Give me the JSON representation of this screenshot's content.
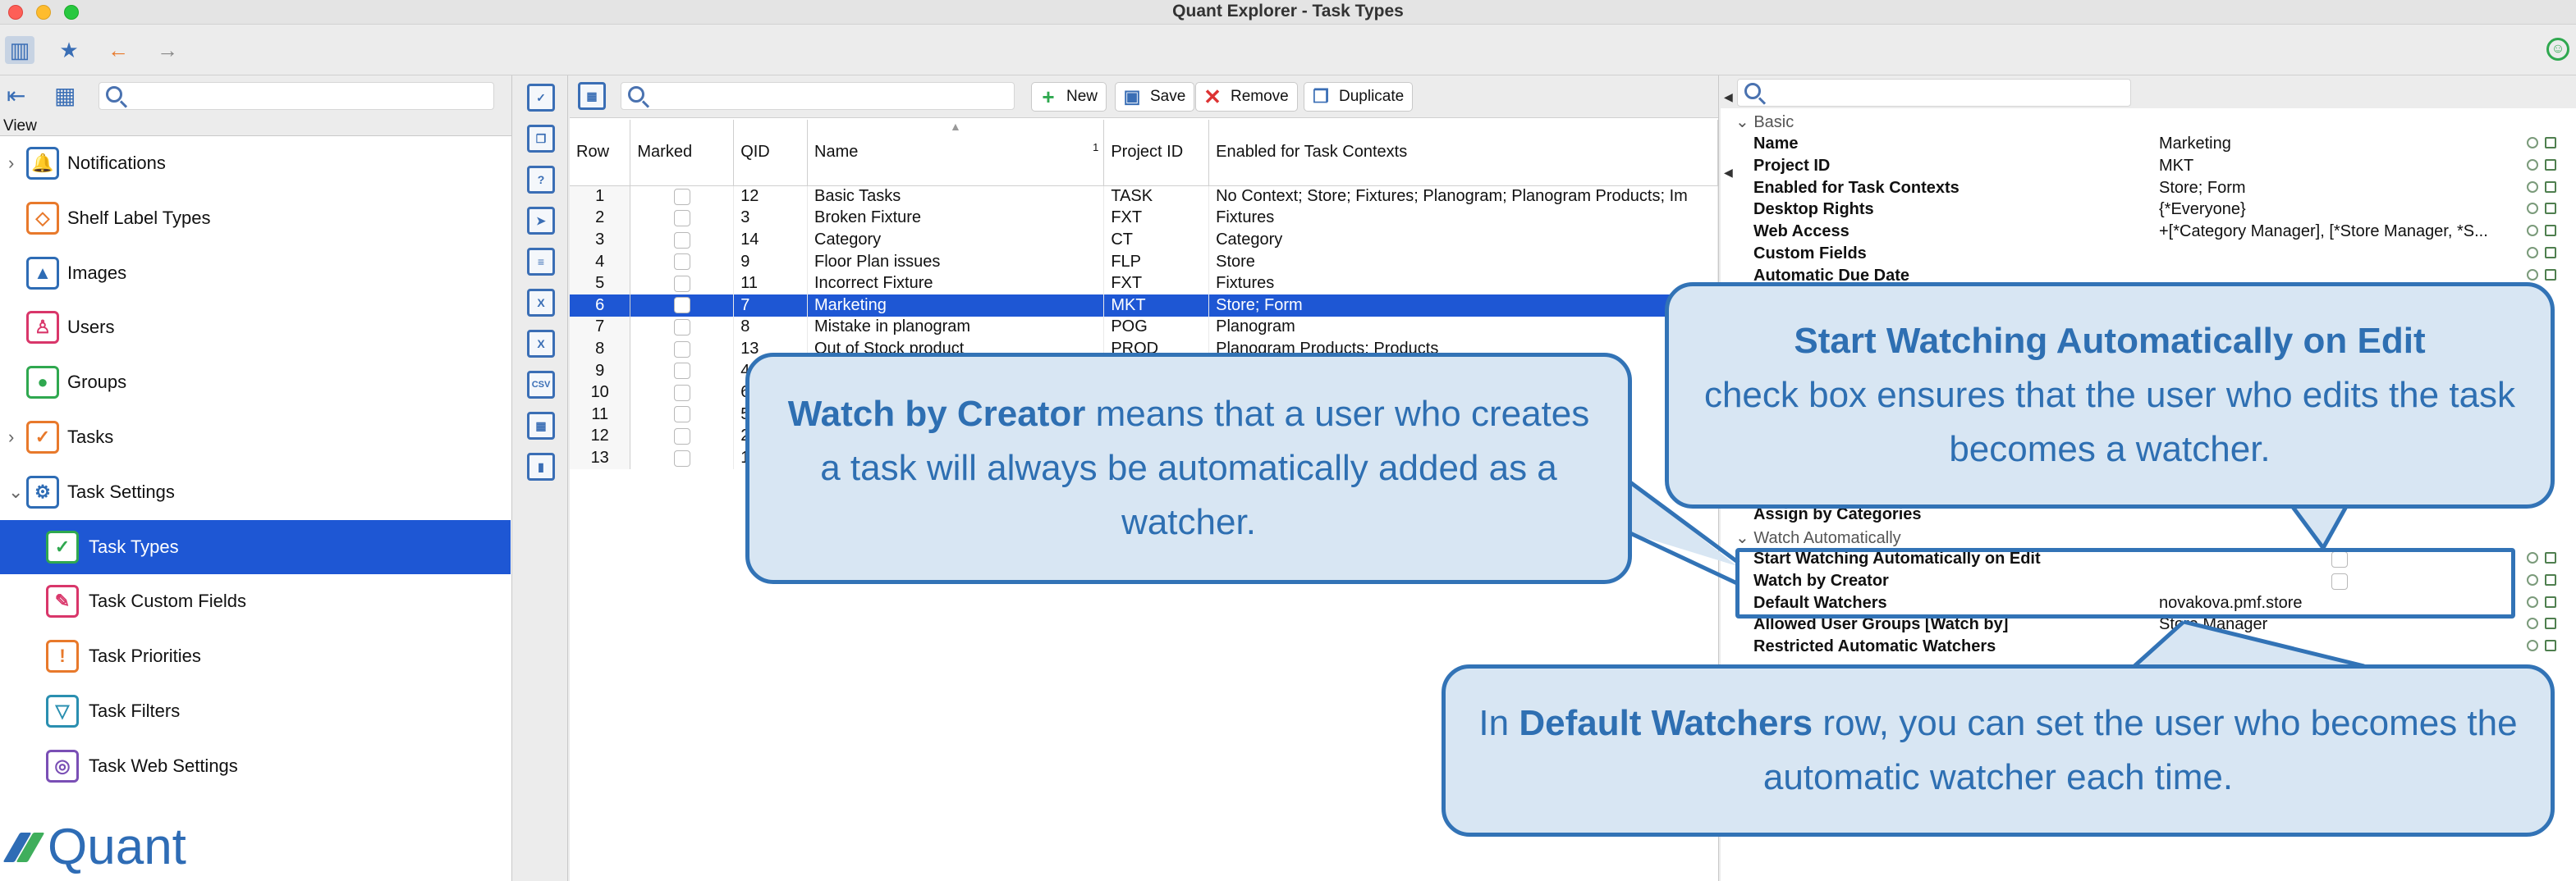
{
  "window": {
    "title": "Quant Explorer - Task Types"
  },
  "left": {
    "view_label": "View",
    "nav": [
      {
        "label": "Notifications",
        "icon": "bell-icon",
        "expandable": true
      },
      {
        "label": "Shelf Label Types",
        "icon": "shelf-label-icon",
        "expandable": false
      },
      {
        "label": "Images",
        "icon": "image-icon",
        "expandable": false
      },
      {
        "label": "Users",
        "icon": "user-icon",
        "expandable": false
      },
      {
        "label": "Groups",
        "icon": "group-icon",
        "expandable": false
      },
      {
        "label": "Tasks",
        "icon": "task-check-icon",
        "expandable": true
      },
      {
        "label": "Task Settings",
        "icon": "task-settings-icon",
        "expandable": true
      },
      {
        "label": "Task Types",
        "icon": "task-types-icon",
        "selected": true
      },
      {
        "label": "Task Custom Fields",
        "icon": "task-custom-fields-icon"
      },
      {
        "label": "Task Priorities",
        "icon": "task-priorities-icon"
      },
      {
        "label": "Task Filters",
        "icon": "task-filters-icon"
      },
      {
        "label": "Task Web Settings",
        "icon": "task-web-icon"
      }
    ],
    "logo_text": "Quant"
  },
  "toolbar": {
    "new_label": "New",
    "save_label": "Save",
    "remove_label": "Remove",
    "duplicate_label": "Duplicate"
  },
  "table": {
    "columns": [
      "Row",
      "Marked",
      "QID",
      "Name",
      "Project ID",
      "Enabled for Task Contexts"
    ],
    "sort_indicator": "1",
    "rows": [
      [
        "1",
        "",
        "12",
        "Basic Tasks",
        "TASK",
        "No Context; Store; Fixtures; Planogram; Planogram Products; Im"
      ],
      [
        "2",
        "",
        "3",
        "Broken Fixture",
        "FXT",
        "Fixtures"
      ],
      [
        "3",
        "",
        "14",
        "Category",
        "CT",
        "Category"
      ],
      [
        "4",
        "",
        "9",
        "Floor Plan issues",
        "FLP",
        "Store"
      ],
      [
        "5",
        "",
        "11",
        "Incorrect Fixture",
        "FXT",
        "Fixtures"
      ],
      [
        "6",
        "",
        "7",
        "Marketing",
        "MKT",
        "Store; Form"
      ],
      [
        "7",
        "",
        "8",
        "Mistake in planogram",
        "POG",
        "Planogram"
      ],
      [
        "8",
        "",
        "13",
        "Out of Stock product",
        "PROD",
        "Planogram Products; Products"
      ],
      [
        "9",
        "",
        "4",
        "",
        "",
        ""
      ],
      [
        "10",
        "",
        "6",
        "",
        "",
        ""
      ],
      [
        "11",
        "",
        "5",
        "",
        "",
        ""
      ],
      [
        "12",
        "",
        "2",
        "",
        "",
        ""
      ],
      [
        "13",
        "",
        "1",
        "",
        "",
        ""
      ]
    ],
    "selected_row": 5
  },
  "properties": {
    "section_basic": "Basic",
    "basic": [
      {
        "key": "Name",
        "value": "Marketing"
      },
      {
        "key": "Project ID",
        "value": "MKT"
      },
      {
        "key": "Enabled for Task Contexts",
        "value": "Store; Form"
      },
      {
        "key": "Desktop Rights",
        "value": "{*Everyone}"
      },
      {
        "key": "Web Access",
        "value": "+[*Category Manager], [*Store Manager, *S..."
      },
      {
        "key": "Custom Fields",
        "value": ""
      },
      {
        "key": "Automatic Due Date",
        "value": ""
      }
    ],
    "assign_label": "Assign by Categories",
    "section_watch": "Watch Automatically",
    "watch": [
      {
        "key": "Start Watching Automatically on Edit",
        "value": "",
        "checkbox": true
      },
      {
        "key": "Watch by Creator",
        "value": "",
        "checkbox": true
      },
      {
        "key": "Default Watchers",
        "value": "novakova.pmf.store"
      },
      {
        "key": "Allowed User Groups [Watch by]",
        "value": "Store Manager"
      },
      {
        "key": "Restricted Automatic Watchers",
        "value": ""
      }
    ]
  },
  "callouts": {
    "creator": {
      "bold": "Watch by Creator",
      "text": " means that a user who creates a task will always be automatically added as a watcher."
    },
    "edit": {
      "bold": "Start Watching Automatically on Edit",
      "text": "check box ensures that the user who edits the task becomes a watcher."
    },
    "default": {
      "pre": "In ",
      "bold": "Default Watchers",
      "text": " row, you can set the user who becomes the automatic watcher each time."
    }
  },
  "colors": {
    "selection": "#1e57d4",
    "callout_fill": "#d8e6f3",
    "callout_border": "#3273b6",
    "callout_text": "#2e6fb2"
  }
}
